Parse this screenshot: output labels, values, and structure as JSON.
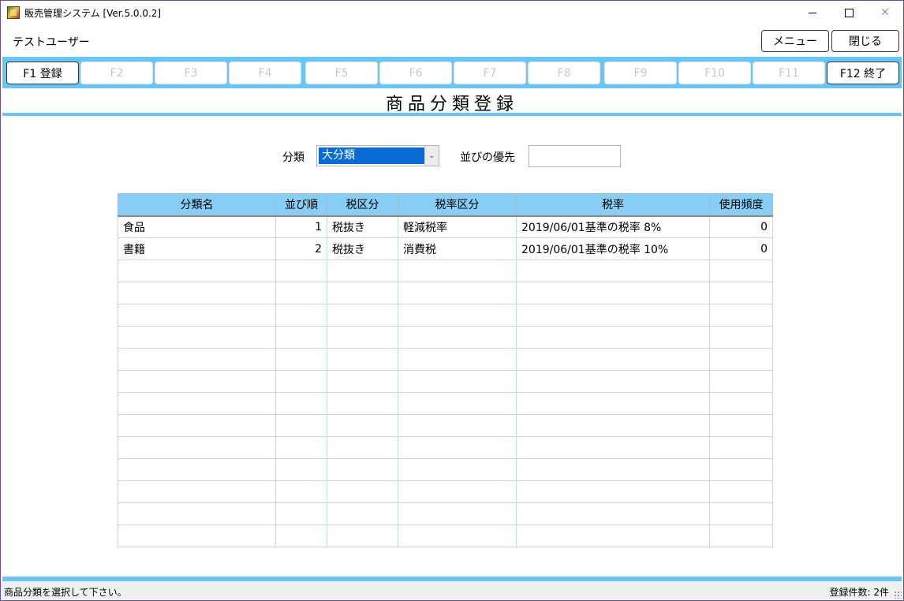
{
  "window": {
    "title": "販売管理システム [Ver.5.0.0.2]",
    "min_icon": "minimize-icon",
    "max_icon": "maximize-icon",
    "close_glyph": "✕"
  },
  "header": {
    "user": "テストユーザー",
    "menu_label": "メニュー",
    "close_label": "閉じる"
  },
  "fkeys": [
    {
      "label": "F1 登録",
      "enabled": true
    },
    {
      "label": "F2",
      "enabled": false
    },
    {
      "label": "F3",
      "enabled": false
    },
    {
      "label": "F4",
      "enabled": false
    },
    {
      "label": "F5",
      "enabled": false
    },
    {
      "label": "F6",
      "enabled": false
    },
    {
      "label": "F7",
      "enabled": false
    },
    {
      "label": "F8",
      "enabled": false
    },
    {
      "label": "F9",
      "enabled": false
    },
    {
      "label": "F10",
      "enabled": false
    },
    {
      "label": "F11",
      "enabled": false
    },
    {
      "label": "F12 終了",
      "enabled": true
    }
  ],
  "page_title": "商品分類登録",
  "filter": {
    "category_label": "分類",
    "category_value": "大分類",
    "sort_label": "並びの優先",
    "sort_value": ""
  },
  "table": {
    "columns": [
      "分類名",
      "並び順",
      "税区分",
      "税率区分",
      "税率",
      "使用頻度"
    ],
    "rows": [
      [
        "食品",
        "1",
        "税抜き",
        "軽減税率",
        "2019/06/01基準の税率 8%",
        "0"
      ],
      [
        "書籍",
        "2",
        "税抜き",
        "消費税",
        "2019/06/01基準の税率 10%",
        "0"
      ]
    ]
  },
  "status": {
    "message": "商品分類を選択して下さい。",
    "count": "登録件数: 2件"
  },
  "colors": {
    "accent": "#67c6f3",
    "header_bg": "#87cdf5",
    "selection": "#0a6cd6"
  }
}
